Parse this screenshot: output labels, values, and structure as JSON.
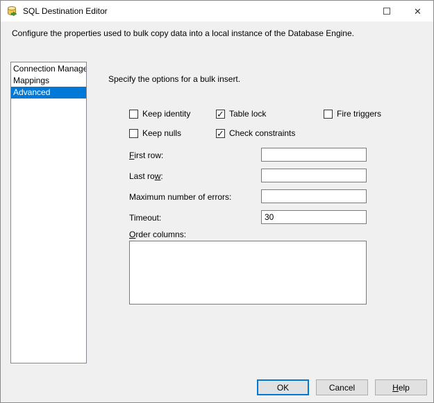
{
  "window": {
    "title": "SQL Destination Editor",
    "close_glyph": "✕"
  },
  "header": {
    "description": "Configure the properties used to bulk copy data into a local instance of the Database Engine."
  },
  "sidebar": {
    "items": [
      {
        "label": "Connection Manager"
      },
      {
        "label": "Mappings"
      },
      {
        "label": "Advanced"
      }
    ],
    "selected": "Advanced"
  },
  "main": {
    "instruction": "Specify the options for a bulk insert.",
    "checkboxes": {
      "keep_identity": {
        "label": "Keep identity",
        "checked": false
      },
      "table_lock": {
        "label": "Table lock",
        "checked": true
      },
      "fire_triggers": {
        "label": "Fire triggers",
        "checked": false
      },
      "keep_nulls": {
        "label": "Keep nulls",
        "checked": false
      },
      "check_constraints": {
        "label": "Check constraints",
        "checked": true
      }
    },
    "fields": {
      "first_row": {
        "label": "First row:",
        "value": ""
      },
      "last_row": {
        "label": "Last row:",
        "value": ""
      },
      "max_errors": {
        "label": "Maximum number of errors:",
        "value": ""
      },
      "timeout": {
        "label": "Timeout:",
        "value": "30"
      }
    },
    "order_columns": {
      "label": "Order columns:",
      "value": ""
    }
  },
  "footer": {
    "ok": "OK",
    "cancel": "Cancel",
    "help": "Help"
  },
  "colors": {
    "accent": "#0078d7",
    "selection_bg": "#0078d7",
    "title_bar_bg": "#ffffff",
    "dialog_bg": "#f0f0f0",
    "button_face": "#e1e1e1",
    "button_border": "#adadad"
  }
}
